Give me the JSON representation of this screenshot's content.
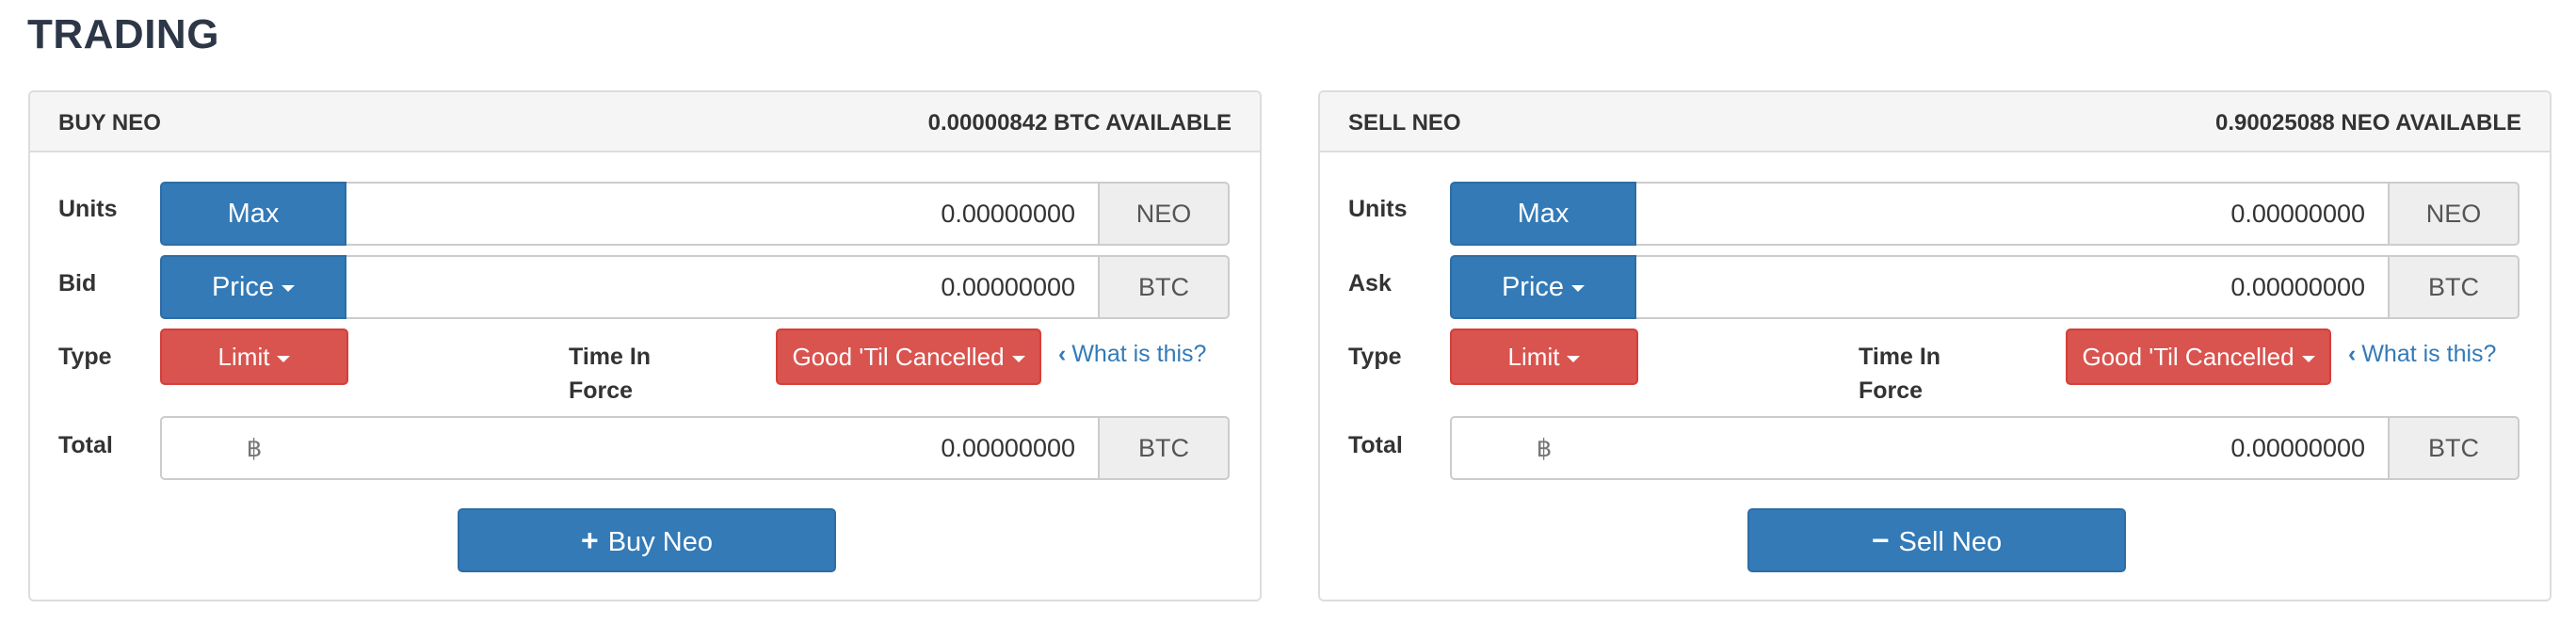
{
  "page": {
    "title": "TRADING"
  },
  "buy": {
    "heading": "BUY NEO",
    "available": "0.00000842 BTC AVAILABLE",
    "units_label": "Units",
    "max_label": "Max",
    "units_value": "0.00000000",
    "units_currency": "NEO",
    "price_row_label": "Bid",
    "price_label": "Price",
    "price_value": "0.00000000",
    "price_currency": "BTC",
    "type_label": "Type",
    "type_value": "Limit",
    "tif_label_1": "Time In",
    "tif_label_2": "Force",
    "tif_value": "Good 'Til Cancelled",
    "help_link": "What is this?",
    "total_label": "Total",
    "total_symbol": "฿",
    "total_value": "0.00000000",
    "total_currency": "BTC",
    "submit_symbol": "+",
    "submit_label": "Buy Neo"
  },
  "sell": {
    "heading": "SELL NEO",
    "available": "0.90025088 NEO AVAILABLE",
    "units_label": "Units",
    "max_label": "Max",
    "units_value": "0.00000000",
    "units_currency": "NEO",
    "price_row_label": "Ask",
    "price_label": "Price",
    "price_value": "0.00000000",
    "price_currency": "BTC",
    "type_label": "Type",
    "type_value": "Limit",
    "tif_label_1": "Time In",
    "tif_label_2": "Force",
    "tif_value": "Good 'Til Cancelled",
    "help_link": "What is this?",
    "total_label": "Total",
    "total_symbol": "฿",
    "total_value": "0.00000000",
    "total_currency": "BTC",
    "submit_symbol": "−",
    "submit_label": "Sell Neo"
  },
  "colors": {
    "primary": "#337ab7",
    "danger": "#d9534f",
    "title": "#2d3747",
    "panel_heading_bg": "#f5f5f5"
  }
}
